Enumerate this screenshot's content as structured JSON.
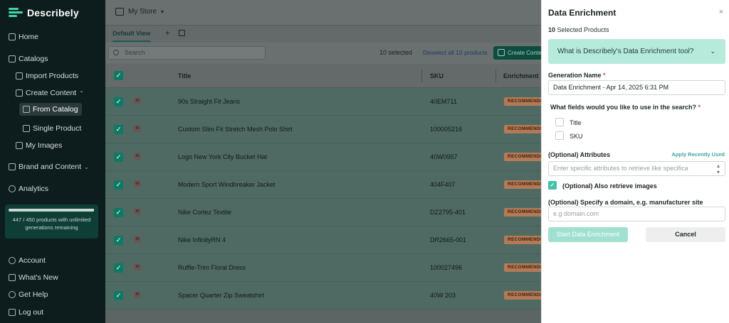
{
  "app": {
    "name": "Describely"
  },
  "sidebar": {
    "home": "Home",
    "catalogs": "Catalogs",
    "import_products": "Import Products",
    "create_content": "Create Content",
    "from_catalog": "From Catalog",
    "single_product": "Single Product",
    "my_images": "My Images",
    "brand_and_content": "Brand and Content",
    "analytics": "Analytics",
    "usage": {
      "text": "447 / 450 products with unlimited generations remaining",
      "fill_fraction": 0.993
    },
    "account": "Account",
    "whats_new": "What's New",
    "get_help": "Get Help",
    "log_out": "Log out"
  },
  "topbar": {
    "store": "My Store"
  },
  "views": {
    "default": "Default View",
    "add": "+"
  },
  "toolbar": {
    "search_placeholder": "Search",
    "selected": "10 selected",
    "deselect": "Deselect all 10 products",
    "create": "Create Content"
  },
  "table": {
    "headers": {
      "title": "Title",
      "sku": "SKU",
      "enrichment": "Enrichment"
    },
    "badge": "RECOMMENDED",
    "rows": [
      {
        "title": "90s Straight Fit Jeans",
        "sku": "40EM711"
      },
      {
        "title": "Custom Slim Fit Stretch Mesh Polo Shirt",
        "sku": "100005216"
      },
      {
        "title": "Logo New York City Bucket Hat",
        "sku": "40W0957"
      },
      {
        "title": "Modern Sport Windbreaker Jacket",
        "sku": "404F407"
      },
      {
        "title": "Nike Cortez Textile",
        "sku": "DZ2795-401"
      },
      {
        "title": "Nike InfinityRN 4",
        "sku": "DR2665-001"
      },
      {
        "title": "Ruffle-Trim Floral Dress",
        "sku": "100027496"
      },
      {
        "title": "Spacer Quarter Zip Sweatshirt",
        "sku": "40W 203"
      }
    ]
  },
  "panel": {
    "title": "Data Enrichment",
    "close": "×",
    "selected_count": "10",
    "selected_label": "Selected Products",
    "accordion": "What is Describely's Data Enrichment tool?",
    "generation_name_label": "Generation Name",
    "generation_name_value": "Data Enrichment - Apr 14, 2025 6:31 PM",
    "fields_question": "What fields would you like to use in the search?",
    "field_title": "Title",
    "field_sku": "SKU",
    "attributes_label": "(Optional) Attributes",
    "apply_recent": "Apply Recently Used",
    "attributes_placeholder": "Enter specific attributes to retrieve like specifica",
    "retrieve_images": "(Optional) Also retrieve images",
    "domain_label": "(Optional) Specify a domain, e.g. manufacturer site",
    "domain_placeholder": "e.g domain.com",
    "start_button": "Start Data Enrichment",
    "cancel_button": "Cancel"
  }
}
